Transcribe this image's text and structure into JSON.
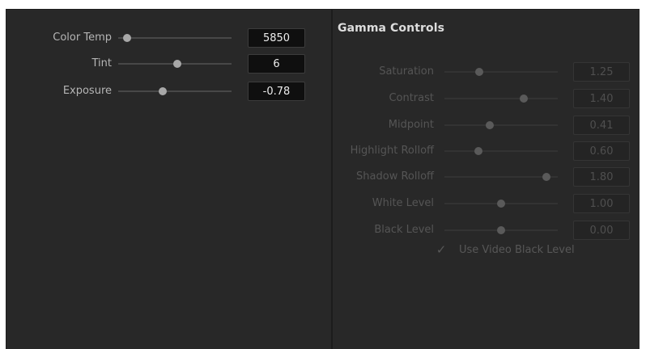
{
  "left_controls": [
    {
      "label": "Color Temp",
      "value": "5850",
      "slider_fraction": 0.08
    },
    {
      "label": "Tint",
      "value": "6",
      "slider_fraction": 0.52
    },
    {
      "label": "Exposure",
      "value": "-0.78",
      "slider_fraction": 0.39
    }
  ],
  "gamma": {
    "title": "Gamma Controls",
    "controls": [
      {
        "label": "Saturation",
        "value": "1.25",
        "slider_fraction": 0.31
      },
      {
        "label": "Contrast",
        "value": "1.40",
        "slider_fraction": 0.7
      },
      {
        "label": "Midpoint",
        "value": "0.41",
        "slider_fraction": 0.4
      },
      {
        "label": "Highlight Rolloff",
        "value": "0.60",
        "slider_fraction": 0.3
      },
      {
        "label": "Shadow Rolloff",
        "value": "1.80",
        "slider_fraction": 0.9
      },
      {
        "label": "White Level",
        "value": "1.00",
        "slider_fraction": 0.5
      },
      {
        "label": "Black Level",
        "value": "0.00",
        "slider_fraction": 0.5
      }
    ],
    "use_video_black_level": {
      "label": "Use Video Black Level",
      "checked": true
    }
  },
  "colors": {
    "panel_bg": "#282828",
    "field_bg": "#0f0f0f",
    "disabled_text": "#555555"
  }
}
